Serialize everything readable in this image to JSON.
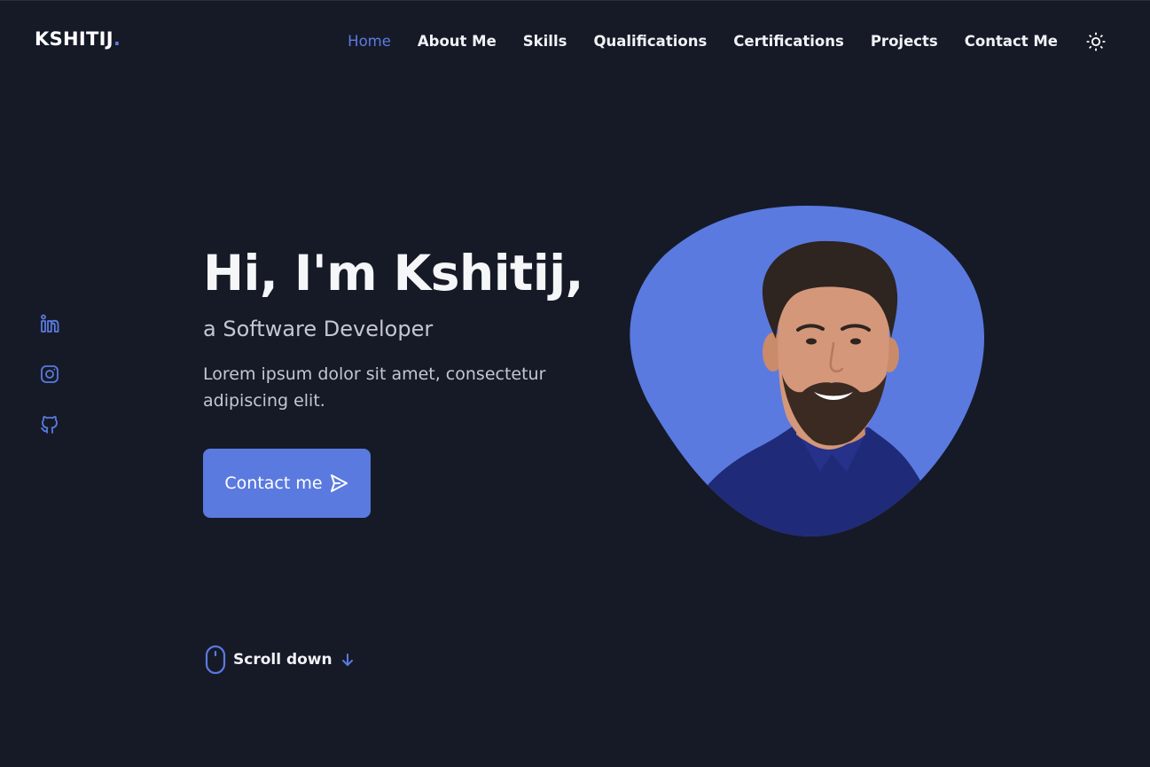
{
  "logo": {
    "text": "KSHITIJ",
    "dot": "."
  },
  "nav": {
    "items": [
      {
        "label": "Home",
        "active": true
      },
      {
        "label": "About Me",
        "active": false
      },
      {
        "label": "Skills",
        "active": false
      },
      {
        "label": "Qualifications",
        "active": false
      },
      {
        "label": "Certifications",
        "active": false
      },
      {
        "label": "Projects",
        "active": false
      },
      {
        "label": "Contact Me",
        "active": false
      }
    ],
    "theme_toggle_icon": "sun-icon"
  },
  "social": [
    {
      "icon": "linkedin-icon"
    },
    {
      "icon": "instagram-icon"
    },
    {
      "icon": "github-icon"
    }
  ],
  "hero": {
    "title": "Hi, I'm Kshitij,",
    "subtitle": "a Software Developer",
    "description": "Lorem ipsum dolor sit amet, consectetur adipiscing elit.",
    "cta_label": "Contact me",
    "cta_icon": "send-icon"
  },
  "scroll": {
    "label": "Scroll down",
    "mouse_icon": "mouse-icon",
    "arrow_icon": "arrow-down-icon"
  },
  "colors": {
    "accent": "#5a7ae0",
    "background": "#161a27",
    "text": "#f1f2f6",
    "muted": "#c4c7d2"
  }
}
